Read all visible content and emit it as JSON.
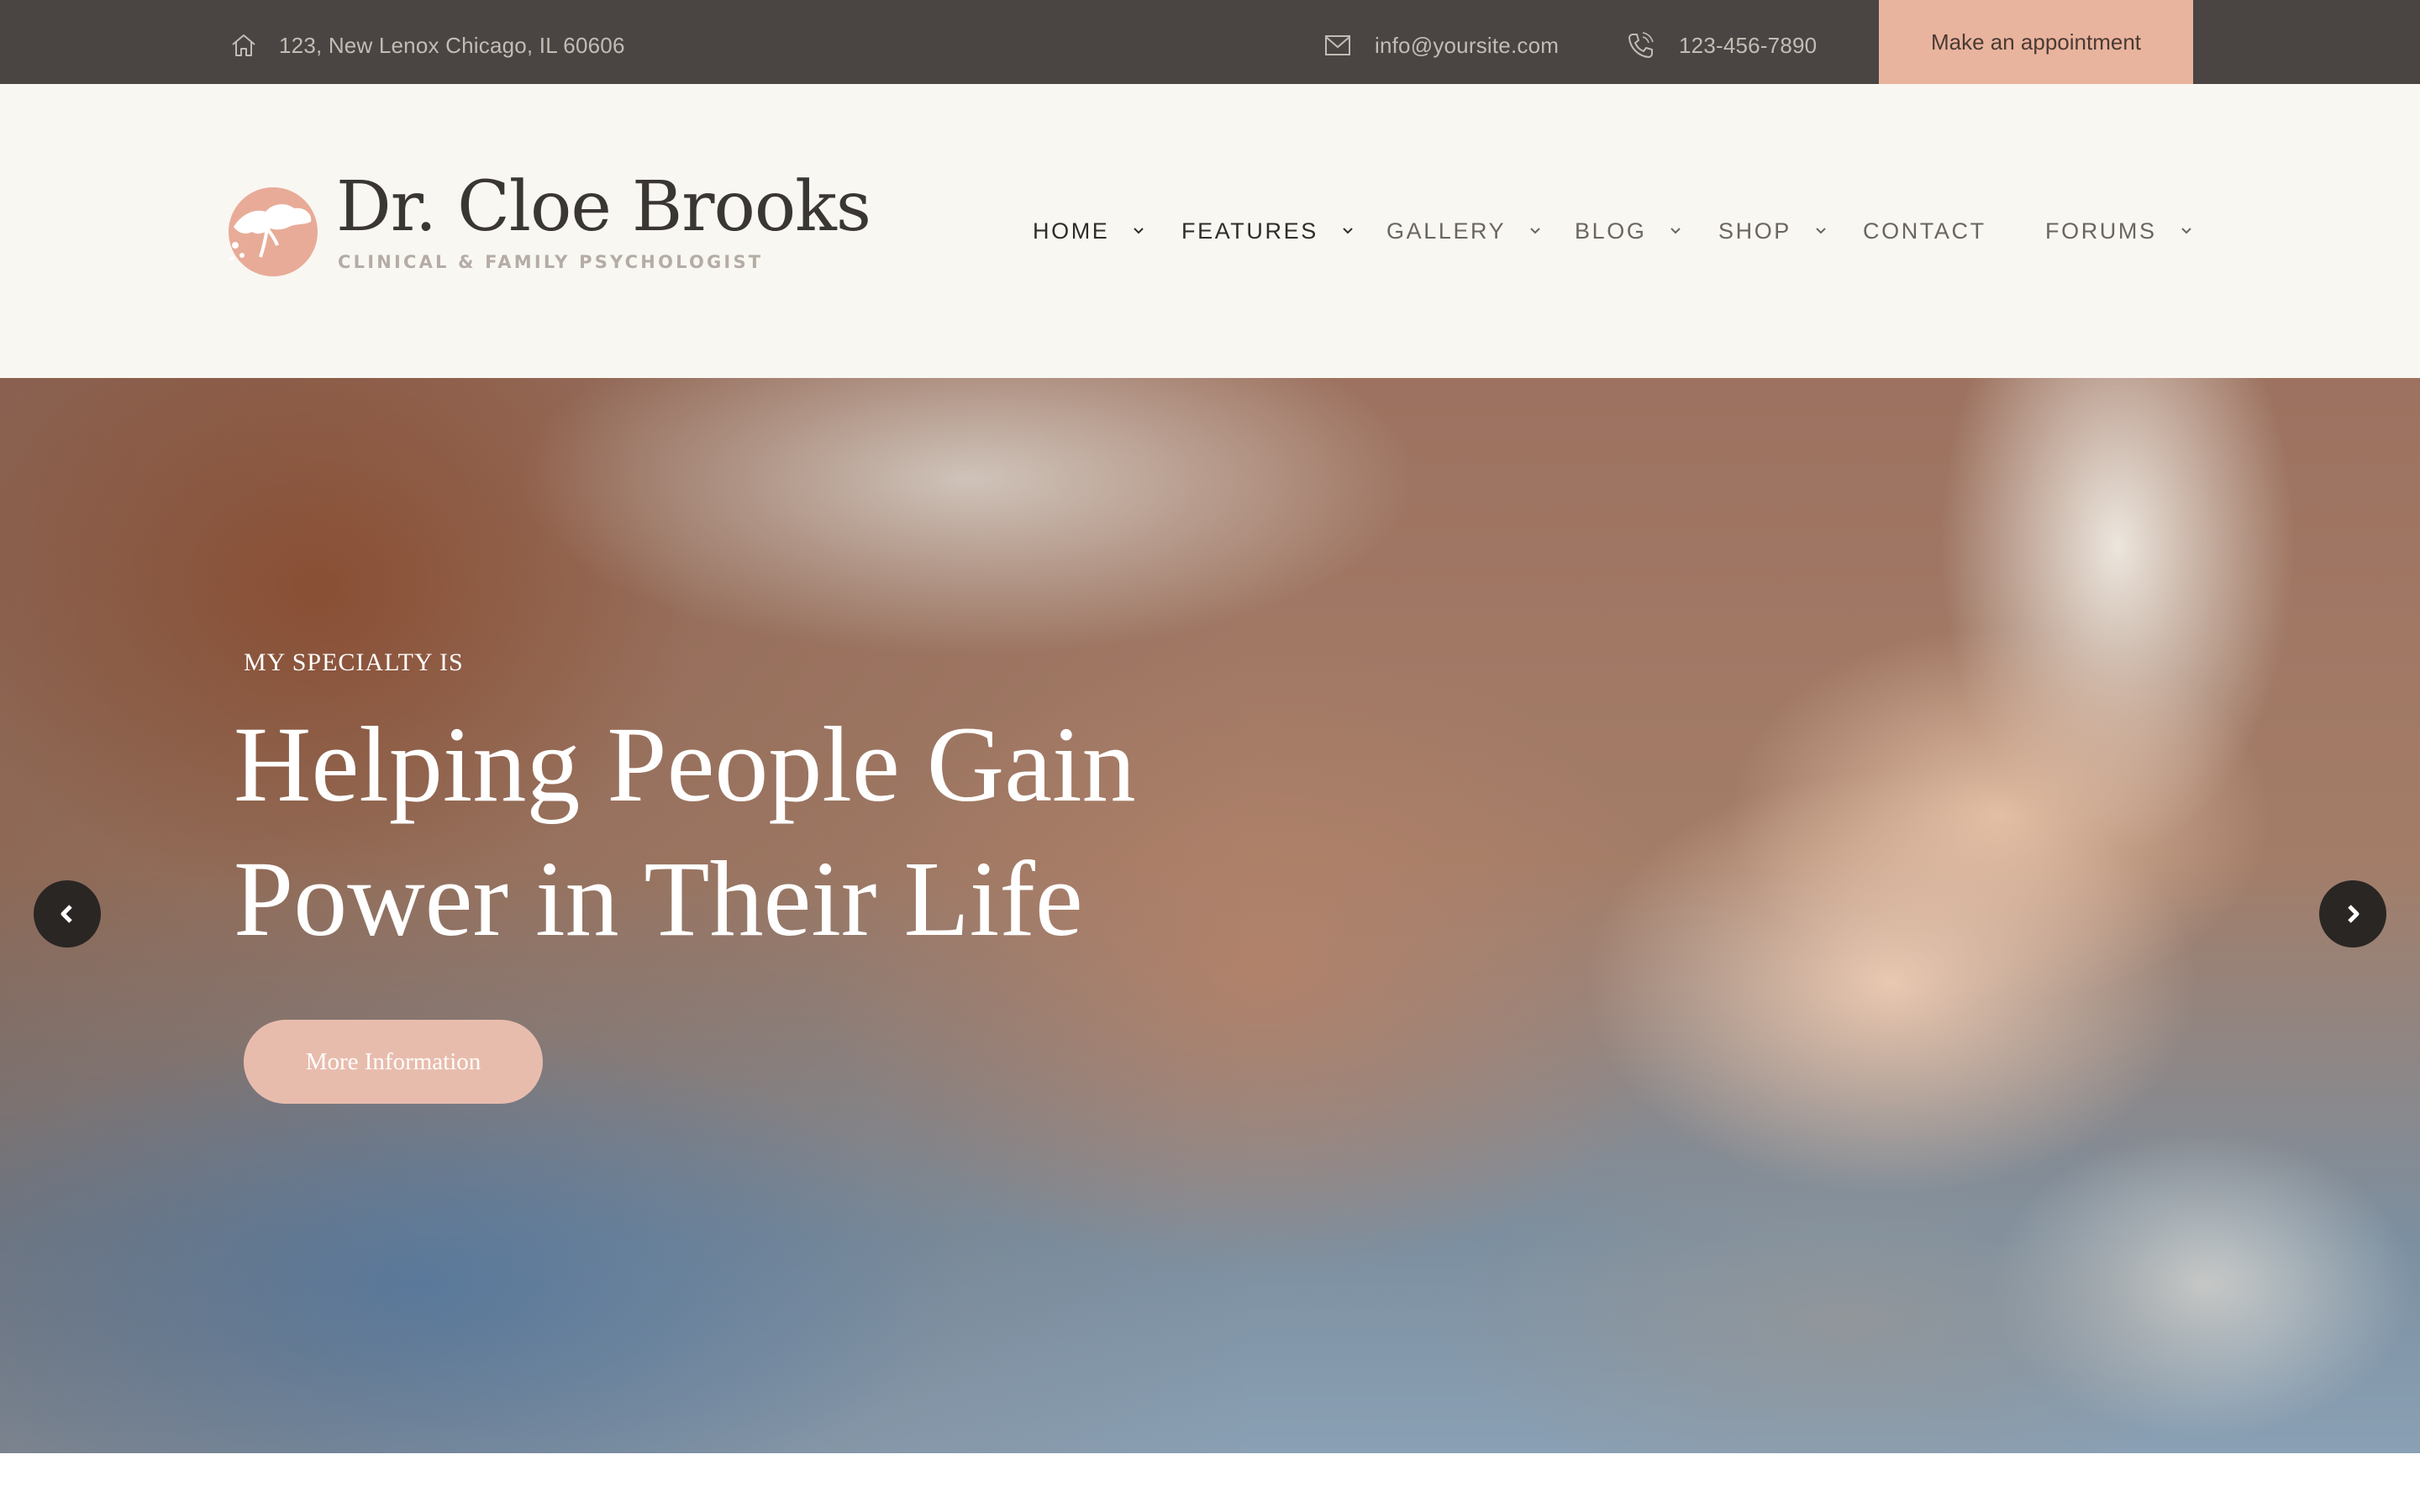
{
  "topbar": {
    "address": "123, New Lenox Chicago, IL 60606",
    "email": "info@yoursite.com",
    "phone": "123-456-7890",
    "appointment_label": "Make an appointment",
    "address_icon": "home-icon",
    "email_icon": "envelope-icon",
    "phone_icon": "phone-icon"
  },
  "logo": {
    "name": "Dr. Cloe Brooks",
    "tagline": "CLINICAL & FAMILY PSYCHOLOGIST"
  },
  "nav": {
    "items": [
      {
        "label": "HOME",
        "has_dropdown": true
      },
      {
        "label": "FEATURES",
        "has_dropdown": true
      },
      {
        "label": "GALLERY",
        "has_dropdown": true
      },
      {
        "label": "BLOG",
        "has_dropdown": true
      },
      {
        "label": "SHOP",
        "has_dropdown": true
      },
      {
        "label": "CONTACT",
        "has_dropdown": false
      },
      {
        "label": "FORUMS",
        "has_dropdown": true
      }
    ]
  },
  "hero": {
    "kicker": "MY SPECIALTY IS",
    "title_line1": "Helping People Gain",
    "title_line2": "Power in Their Life",
    "button_label": "More Information"
  },
  "colors": {
    "topbar_bg": "#4a4542",
    "accent": "#e9b49e",
    "header_bg": "#f9f7f2",
    "hero_button": "#e8bcad"
  }
}
